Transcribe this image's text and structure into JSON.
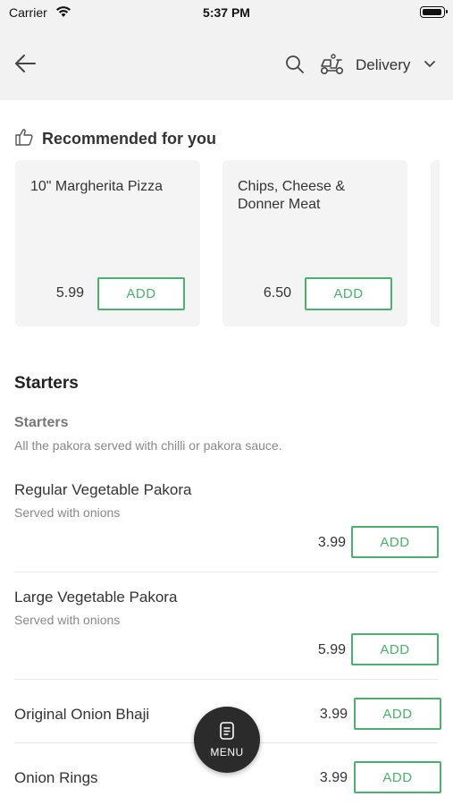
{
  "status_bar": {
    "carrier": "Carrier",
    "time": "5:37 PM"
  },
  "header": {
    "delivery_mode": "Delivery"
  },
  "recommended": {
    "title": "Recommended for you",
    "items": [
      {
        "name": "10\" Margherita Pizza",
        "price": "5.99",
        "add_label": "ADD"
      },
      {
        "name": "Chips, Cheese & Donner Meat",
        "price": "6.50",
        "add_label": "ADD"
      }
    ]
  },
  "menu": {
    "section_title": "Starters",
    "subsection_title": "Starters",
    "subsection_description": "All the pakora served with chilli or pakora sauce.",
    "items": [
      {
        "name": "Regular Vegetable Pakora",
        "description": "Served with onions",
        "price": "3.99",
        "add_label": "ADD"
      },
      {
        "name": "Large Vegetable Pakora",
        "description": "Served with onions",
        "price": "5.99",
        "add_label": "ADD"
      },
      {
        "name": "Original Onion Bhaji",
        "description": "",
        "price": "3.99",
        "add_label": "ADD"
      },
      {
        "name": "Onion Rings",
        "description": "",
        "price": "3.99",
        "add_label": "ADD"
      }
    ]
  },
  "fab": {
    "label": "MENU"
  },
  "colors": {
    "accent": "#4caf6e",
    "header_bg": "#f2f2f2",
    "fab_bg": "#2b2b2b"
  },
  "icons": [
    "wifi-icon",
    "battery-icon",
    "back-arrow-icon",
    "search-icon",
    "scooter-icon",
    "chevron-down-icon",
    "thumbs-up-icon",
    "menu-icon"
  ]
}
